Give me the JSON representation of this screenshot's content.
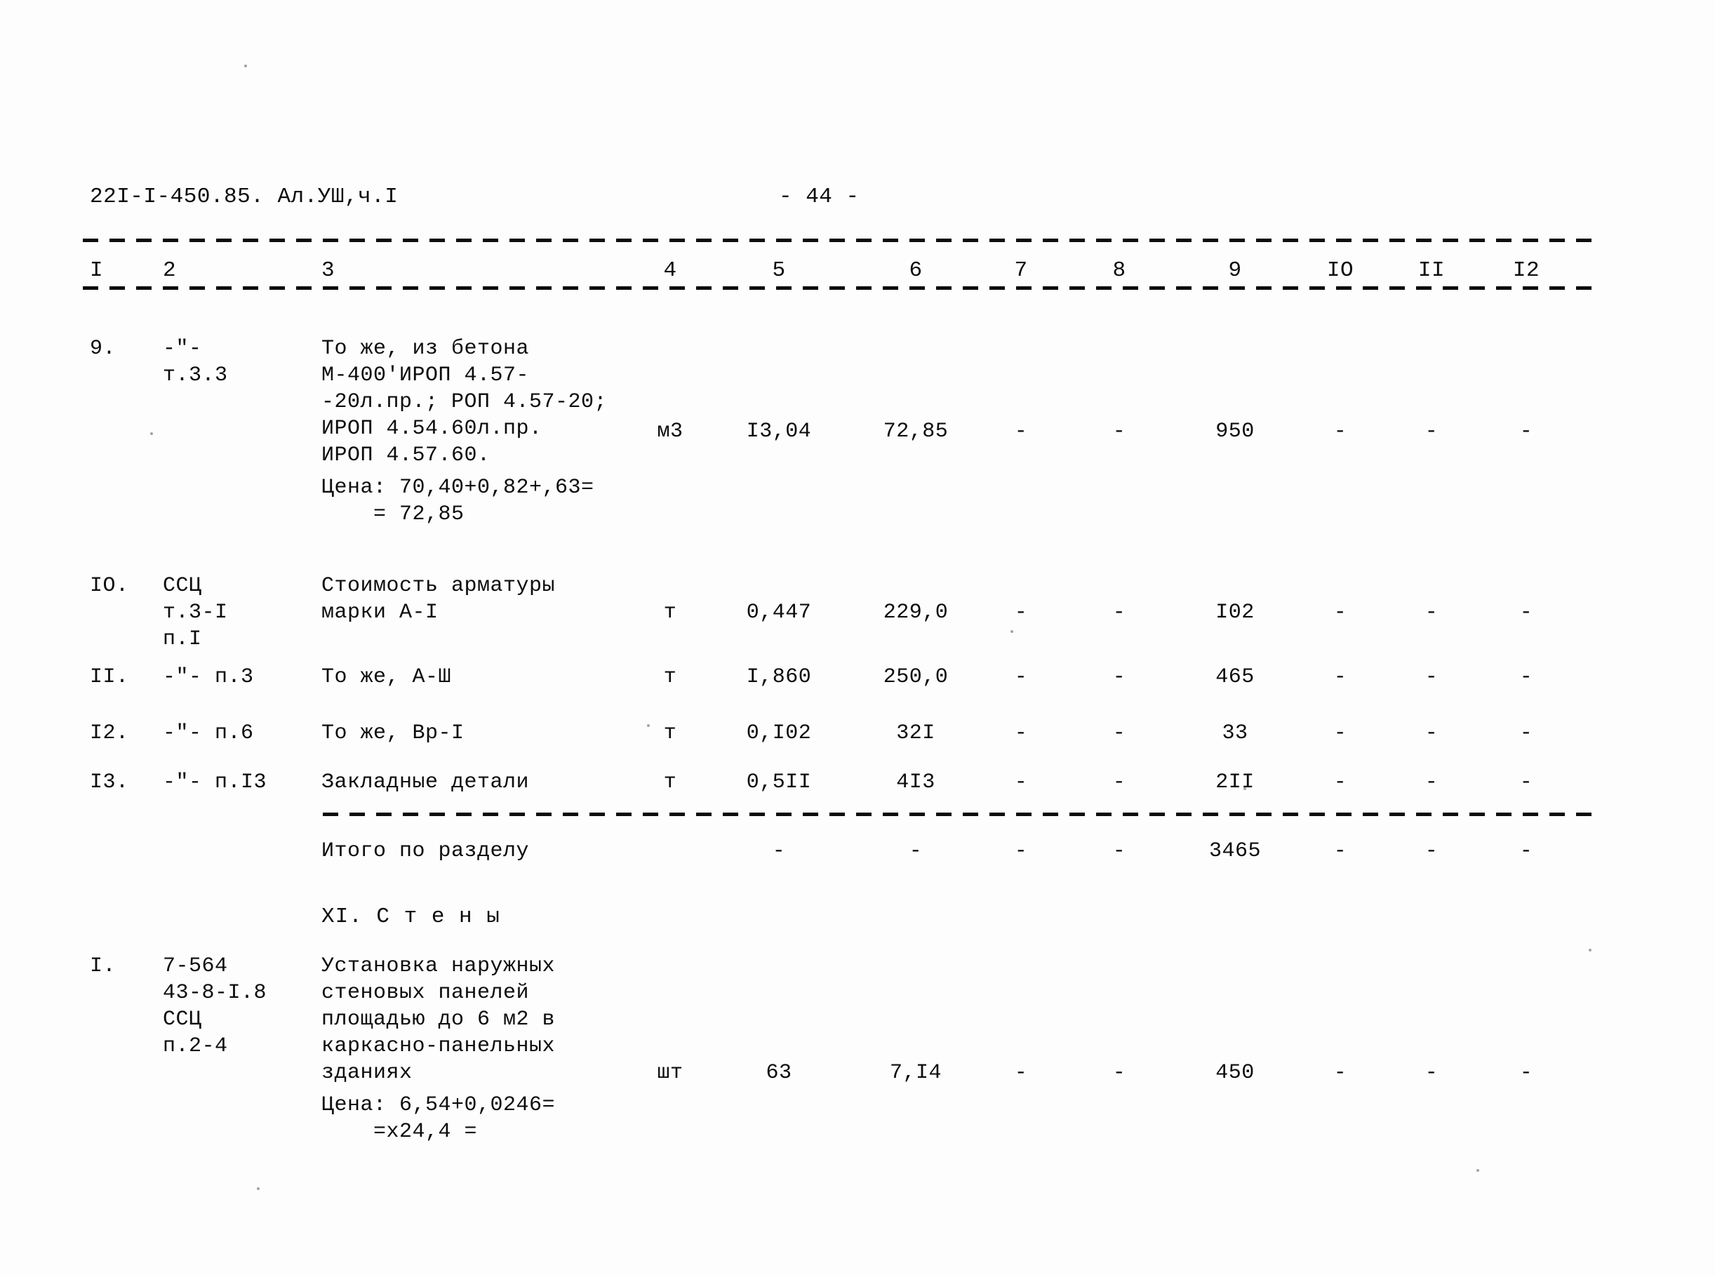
{
  "document": {
    "header_code": "22I-I-450.85. Ал.УШ,ч.I",
    "page_marker": "- 44 -"
  },
  "table": {
    "column_numbers": [
      "I",
      "2",
      "3",
      "4",
      "5",
      "6",
      "7",
      "8",
      "9",
      "IO",
      "II",
      "I2"
    ],
    "dash_symbol": "-",
    "rows": [
      {
        "num": "9.",
        "code_lines": [
          "-\"-",
          "т.3.3"
        ],
        "desc_lines": [
          "То же, из бетона",
          "М-400'ИРОП 4.57-",
          "-20л.пр.; РОП 4.57-20;",
          "ИРОП 4.54.60л.пр.",
          "ИРОП 4.57.60."
        ],
        "unit": "м3",
        "qty": "I3,04",
        "price": "72,85",
        "c7": "-",
        "c8": "-",
        "c9": "950",
        "c10": "-",
        "c11": "-",
        "c12": "-",
        "note_lines": [
          "Цена: 70,40+0,82+,63=",
          "    = 72,85"
        ]
      },
      {
        "num": "IO.",
        "code_lines": [
          "ССЦ",
          "т.3-I",
          "п.I"
        ],
        "desc_lines": [
          "Стоимость арматуры",
          "марки А-I"
        ],
        "unit": "т",
        "qty": "0,447",
        "price": "229,0",
        "c7": "-",
        "c8": "-",
        "c9": "I02",
        "c10": "-",
        "c11": "-",
        "c12": "-",
        "note_lines": []
      },
      {
        "num": "II.",
        "code_lines": [
          "-\"- п.3"
        ],
        "desc_lines": [
          "То же, А-Ш"
        ],
        "unit": "т",
        "qty": "I,860",
        "price": "250,0",
        "c7": "-",
        "c8": "-",
        "c9": "465",
        "c10": "-",
        "c11": "-",
        "c12": "-",
        "note_lines": []
      },
      {
        "num": "I2.",
        "code_lines": [
          "-\"- п.6"
        ],
        "desc_lines": [
          "То же, Вр-I"
        ],
        "unit": "т",
        "qty": "0,I02",
        "price": "32I",
        "c7": "-",
        "c8": "-",
        "c9": "33",
        "c10": "-",
        "c11": "-",
        "c12": "-",
        "note_lines": []
      },
      {
        "num": "I3.",
        "code_lines": [
          "-\"- п.I3"
        ],
        "desc_lines": [
          "Закладные детали"
        ],
        "unit": "т",
        "qty": "0,5II",
        "price": "4I3",
        "c7": "-",
        "c8": "-",
        "c9": "2II",
        "c10": "-",
        "c11": "-",
        "c12": "-",
        "note_lines": []
      }
    ],
    "summary": {
      "label": "Итого по разделу",
      "c5": "-",
      "c6": "-",
      "c7": "-",
      "c8": "-",
      "c9": "3465",
      "c10": "-",
      "c11": "-",
      "c12": "-"
    },
    "section_heading": "XI. С т е н ы",
    "section_rows": [
      {
        "num": "I.",
        "code_lines": [
          "7-564",
          "43-8-I.8",
          "ССЦ",
          "п.2-4"
        ],
        "desc_lines": [
          "Установка наружных",
          "стеновых панелей",
          "площадью до 6 м2 в",
          "каркасно-панельных",
          "зданиях"
        ],
        "unit": "шт",
        "qty": "63",
        "price": "7,I4",
        "c7": "-",
        "c8": "-",
        "c9": "450",
        "c10": "-",
        "c11": "-",
        "c12": "-",
        "note_lines": [
          "Цена: 6,54+0,0246=",
          "    =х24,4 ="
        ]
      }
    ]
  }
}
